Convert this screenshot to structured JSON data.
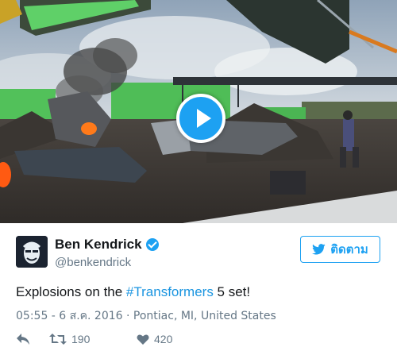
{
  "media": {
    "scene": "film-set-explosion",
    "play_button_color": "#1da1f2"
  },
  "tweet": {
    "display_name": "Ben Kendrick",
    "handle": "@benkendrick",
    "verified": true,
    "follow_label": "ติดตาม",
    "text_before": "Explosions on the ",
    "hashtag": "#Transformers",
    "text_after": " 5 set!",
    "timestamp": "05:55 - 6 ส.ค. 2016",
    "separator": " · ",
    "location": "Pontiac, MI, United States",
    "retweets": "190",
    "likes": "420"
  },
  "colors": {
    "accent": "#1da1f2",
    "text": "#14171a",
    "muted": "#657786",
    "link": "#1b95e0"
  },
  "icons": [
    "play-icon",
    "verified-icon",
    "twitter-bird-icon",
    "reply-icon",
    "retweet-icon",
    "heart-icon"
  ]
}
